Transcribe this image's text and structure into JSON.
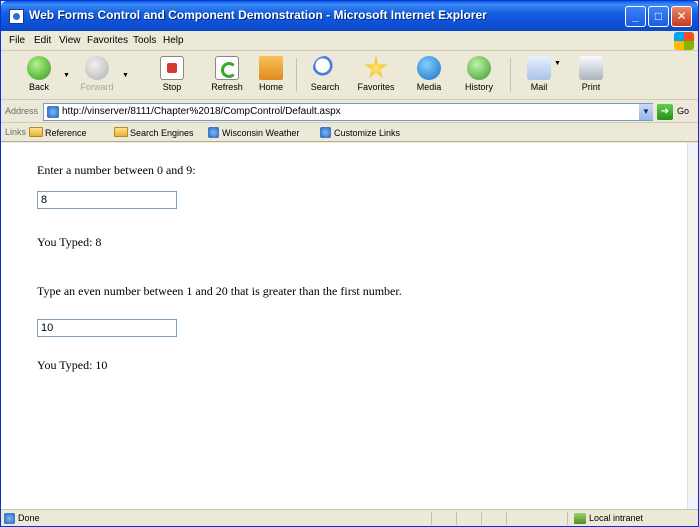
{
  "window": {
    "title": "Web Forms Control and Component Demonstration - Microsoft Internet Explorer",
    "minimize_glyph": "_",
    "maximize_glyph": "□",
    "close_glyph": "✕"
  },
  "menu": [
    "File",
    "Edit",
    "View",
    "Favorites",
    "Tools",
    "Help"
  ],
  "toolbar": {
    "back": "Back",
    "forward": "Forward",
    "stop": "Stop",
    "refresh": "Refresh",
    "home": "Home",
    "search": "Search",
    "favorites": "Favorites",
    "media": "Media",
    "history": "History",
    "mail": "Mail",
    "print": "Print"
  },
  "address": {
    "label": "Address",
    "url": "http://vinserver/8111/Chapter%2018/CompControl/Default.aspx",
    "go": "Go",
    "go_arrow": "➜",
    "dropdown_glyph": "▼"
  },
  "links": {
    "label": "Links",
    "items": [
      "Reference",
      "Search Engines",
      "Wisconsin Weather",
      "Customize Links"
    ]
  },
  "page": {
    "prompt1": "Enter a number between 0 and 9:",
    "input1": "8",
    "echo1": "You Typed: 8",
    "prompt2": "Type an even number between 1 and 20 that is greater than the first number.",
    "input2": "10",
    "echo2": "You Typed: 10"
  },
  "status": {
    "text": "Done",
    "zone": "Local intranet"
  }
}
